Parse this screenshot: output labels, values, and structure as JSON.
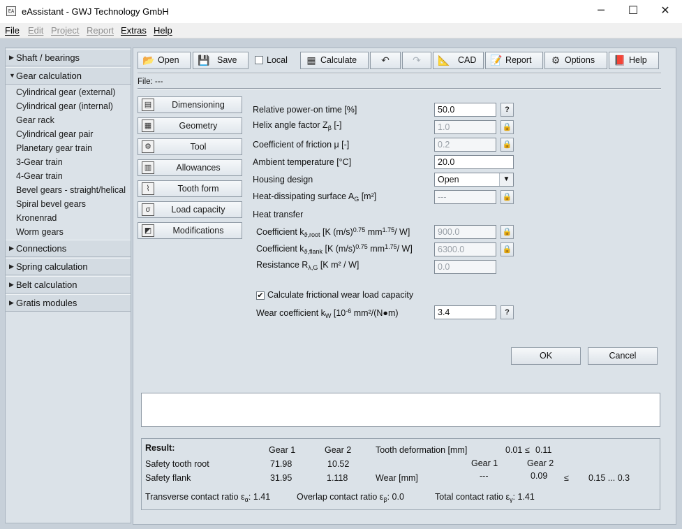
{
  "window": {
    "app_icon": "EA",
    "title": "eAssistant - GWJ Technology GmbH",
    "minimize_icon": "─",
    "maximize_icon": "☐",
    "close_icon": "✕"
  },
  "menu": [
    {
      "label": "File",
      "enabled": true
    },
    {
      "label": "Edit",
      "enabled": false
    },
    {
      "label": "Project",
      "enabled": false
    },
    {
      "label": "Report",
      "enabled": false
    },
    {
      "label": "Extras",
      "enabled": true
    },
    {
      "label": "Help",
      "enabled": true
    }
  ],
  "sidebar": {
    "groups": [
      {
        "label": "Shaft / bearings",
        "expanded": false
      },
      {
        "label": "Gear calculation",
        "expanded": true
      },
      {
        "label": "Connections",
        "expanded": false
      },
      {
        "label": "Spring calculation",
        "expanded": false
      },
      {
        "label": "Belt calculation",
        "expanded": false
      },
      {
        "label": "Gratis modules",
        "expanded": false
      }
    ],
    "gear_items": [
      "Cylindrical gear (external)",
      "Cylindrical gear (internal)",
      "Gear rack",
      "Cylindrical gear pair",
      "Planetary gear train",
      "3-Gear train",
      "4-Gear train",
      "Bevel gears - straight/helical",
      "Spiral bevel gears",
      "Kronenrad",
      "Worm gears"
    ]
  },
  "toolbar": {
    "open": "Open",
    "save": "Save",
    "local": "Local",
    "local_checked": false,
    "calculate": "Calculate",
    "cad": "CAD",
    "report": "Report",
    "options": "Options",
    "help": "Help"
  },
  "file_line": "File: ---",
  "side_tabs": [
    "Dimensioning",
    "Geometry",
    "Tool",
    "Allowances",
    "Tooth form",
    "Load capacity",
    "Modifications"
  ],
  "form": {
    "power_on_time": {
      "label": "Relative power-on time [%]",
      "value": "50.0",
      "help": "?"
    },
    "helix_factor": {
      "label_main": "Helix angle factor Z",
      "label_sub": "β",
      "label_unit": " [-]",
      "value": "1.0"
    },
    "friction": {
      "label": "Coefficient of friction μ [-]",
      "value": "0.2"
    },
    "ambient_temp": {
      "label": "Ambient temperature [°C]",
      "value": "20.0"
    },
    "housing": {
      "label": "Housing design",
      "value": "Open"
    },
    "heat_surface": {
      "label_main": "Heat-dissipating surface A",
      "label_sub": "G",
      "label_unit": " [m²]",
      "value": "---"
    },
    "heat_transfer_title": "Heat transfer",
    "coef_root": {
      "pre": "Coefficient k",
      "sub": "ϑ,root",
      "mid": " [K (m/s)",
      "sup1": "0.75",
      "mid2": " mm",
      "sup2": "1.75",
      "end": "/ W]",
      "value": "900.0"
    },
    "coef_flank": {
      "pre": "Coefficient k",
      "sub": "ϑ,flank",
      "mid": " [K (m/s)",
      "sup1": "0.75",
      "mid2": " mm",
      "sup2": "1.75",
      "end": "/ W]",
      "value": "6300.0"
    },
    "resistance": {
      "pre": "Resistance R",
      "sub": "λ,G",
      "end": " [K m² / W]",
      "value": "0.0"
    },
    "wear_check": {
      "label": "Calculate frictional wear load capacity",
      "checked": true
    },
    "wear_coef": {
      "pre": "Wear coefficient k",
      "sub": "W",
      "mid": " [10",
      "sup": "-6",
      "end": " mm²/(N●m)",
      "value": "3.4",
      "help": "?"
    },
    "lock_icon": "🔒"
  },
  "buttons": {
    "ok": "OK",
    "cancel": "Cancel"
  },
  "results": {
    "title": "Result:",
    "gear1": "Gear 1",
    "gear2": "Gear 2",
    "tooth_deformation_label": "Tooth deformation [mm]",
    "tooth_deformation_value": "0.01",
    "le": "≤",
    "tooth_deformation_limit": "0.11",
    "wear_gear1": "Gear 1",
    "wear_gear2": "Gear 2",
    "safety_root_label": "Safety tooth root",
    "safety_root_g1": "71.98",
    "safety_root_g2": "10.52",
    "safety_flank_label": "Safety flank",
    "safety_flank_g1": "31.95",
    "safety_flank_g2": "1.118",
    "wear_label": "Wear [mm]",
    "wear_g1": "---",
    "wear_g2": "0.09",
    "wear_limit": "0.15 ... 0.3",
    "transverse": {
      "pre": "Transverse contact ratio ε",
      "sub": "α",
      "end": ": 1.41"
    },
    "overlap": {
      "pre": "Overlap contact ratio ε",
      "sub": "β",
      "end": ": 0.0"
    },
    "total": {
      "pre": "Total contact ratio ε",
      "sub": "γ",
      "end": ": 1.41"
    }
  },
  "icons": {
    "open": "folder-open-icon",
    "save": "save-disk-icon",
    "calculate": "calculator-icon",
    "undo": "undo-icon",
    "redo": "redo-icon",
    "cad": "cad-drawing-icon",
    "report": "report-icon",
    "options": "options-icon",
    "help": "help-book-icon"
  }
}
